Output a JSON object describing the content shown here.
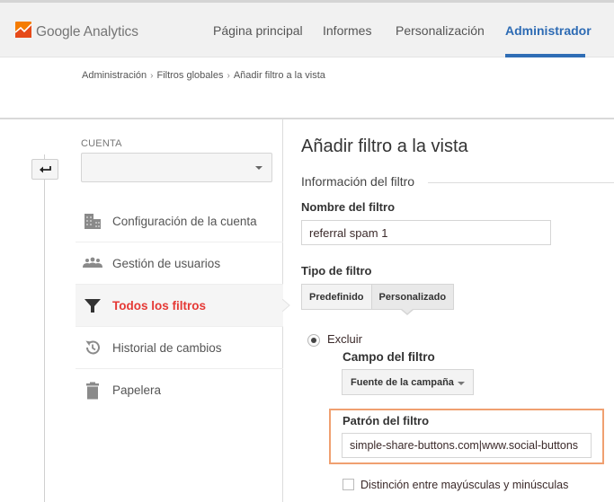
{
  "header": {
    "app_name": "Google Analytics",
    "logo_icon": "analytics-logo-icon",
    "nav": [
      {
        "label": "Página principal",
        "active": false
      },
      {
        "label": "Informes",
        "active": false
      },
      {
        "label": "Personalización",
        "active": false
      },
      {
        "label": "Administrador",
        "active": true
      }
    ],
    "active_color": "#2d6bb4"
  },
  "breadcrumb": {
    "items": [
      "Administración",
      "Filtros globales",
      "Añadir filtro a la vista"
    ],
    "separator": "›"
  },
  "sidebar": {
    "back_icon": "back-arrow-icon",
    "account_label": "CUENTA",
    "account_value": "",
    "items": [
      {
        "label": "Configuración de la cuenta",
        "icon": "building-icon",
        "active": false
      },
      {
        "label": "Gestión de usuarios",
        "icon": "users-icon",
        "active": false
      },
      {
        "label": "Todos los filtros",
        "icon": "filter-icon",
        "active": true
      },
      {
        "label": "Historial de cambios",
        "icon": "history-icon",
        "active": false
      },
      {
        "label": "Papelera",
        "icon": "trash-icon",
        "active": false
      }
    ],
    "active_color": "#e53935"
  },
  "main": {
    "title": "Añadir filtro a la vista",
    "section_title": "Información del filtro",
    "filter_name": {
      "label": "Nombre del filtro",
      "value": "referral spam 1"
    },
    "filter_type": {
      "label": "Tipo de filtro",
      "options": [
        "Predefinido",
        "Personalizado"
      ],
      "selected": "Personalizado"
    },
    "exclude": {
      "label": "Excluir",
      "selected": true
    },
    "filter_field": {
      "label": "Campo del filtro",
      "value": "Fuente de la campaña"
    },
    "filter_pattern": {
      "label": "Patrón del filtro",
      "value": "simple-share-buttons.com|www.social-buttons",
      "highlight_color": "#f0a070"
    },
    "case_sensitive": {
      "label": "Distinción entre mayúsculas y minúsculas",
      "checked": false
    }
  }
}
